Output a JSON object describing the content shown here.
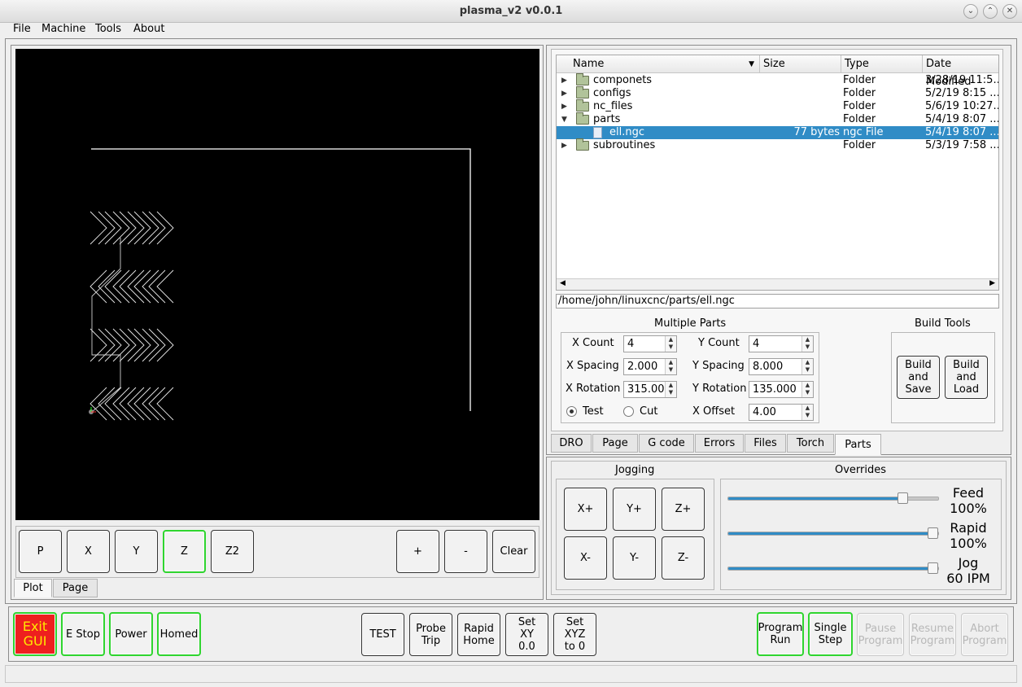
{
  "window": {
    "title": "plasma_v2 v0.0.1",
    "controls": [
      "⌄",
      "⌃",
      "✕"
    ]
  },
  "menu": [
    "File",
    "Machine",
    "Tools",
    "About"
  ],
  "plot_buttons": [
    "P",
    "X",
    "Y",
    "Z",
    "Z2",
    "+",
    "-",
    "Clear"
  ],
  "plot_tabs": [
    "Plot",
    "Page"
  ],
  "files": {
    "columns": [
      "Name",
      "Size",
      "Type",
      "Date Modified"
    ],
    "rows": [
      {
        "name": "componets",
        "size": "",
        "type": "Folder",
        "date": "3/28/19 11:5..."
      },
      {
        "name": "configs",
        "size": "",
        "type": "Folder",
        "date": "5/2/19 8:15 ..."
      },
      {
        "name": "nc_files",
        "size": "",
        "type": "Folder",
        "date": "5/6/19 10:27..."
      },
      {
        "name": "parts",
        "size": "",
        "type": "Folder",
        "date": "5/4/19 8:07 ..."
      },
      {
        "name": "ell.ngc",
        "size": "77 bytes",
        "type": "ngc File",
        "date": "5/4/19 8:07 ..."
      },
      {
        "name": "subroutines",
        "size": "",
        "type": "Folder",
        "date": "5/3/19 7:58 ..."
      }
    ],
    "path": "/home/john/linuxcnc/parts/ell.ngc"
  },
  "multiple_parts": {
    "title": "Multiple Parts",
    "x_count_label": "X Count",
    "x_count": "4",
    "y_count_label": "Y Count",
    "y_count": "4",
    "x_spacing_label": "X Spacing",
    "x_spacing": "2.000",
    "y_spacing_label": "Y Spacing",
    "y_spacing": "8.000",
    "x_rotation_label": "X Rotation",
    "x_rotation": "315.000",
    "y_rotation_label": "Y Rotation",
    "y_rotation": "135.000",
    "test_label": "Test",
    "cut_label": "Cut",
    "x_offset_label": "X Offset",
    "x_offset": "4.00"
  },
  "build_tools": {
    "title": "Build Tools",
    "build_save": "Build\nand\nSave",
    "build_load": "Build\nand\nLoad"
  },
  "right_tabs": [
    "DRO",
    "Page",
    "G code",
    "Errors",
    "Files",
    "Torch",
    "Parts"
  ],
  "jogging": {
    "title": "Jogging",
    "buttons": [
      "X+",
      "Y+",
      "Z+",
      "X-",
      "Y-",
      "Z-"
    ]
  },
  "overrides": {
    "title": "Overrides",
    "feed_label": "Feed",
    "feed_value": "100%",
    "feed_level": 0.85,
    "rapid_label": "Rapid",
    "rapid_value": "100%",
    "rapid_level": 1.0,
    "jog_label": "Jog",
    "jog_value": "60 IPM",
    "jog_level": 1.0
  },
  "bottom": {
    "exit": "Exit\nGUI",
    "estop": "E Stop",
    "power": "Power",
    "homed": "Homed",
    "test": "TEST",
    "probe": "Probe\nTrip",
    "rapid_home": "Rapid\nHome",
    "set_xy": "Set\nXY\n0.0",
    "set_xyz": "Set\nXYZ\nto 0",
    "program_run": "Program\nRun",
    "single_step": "Single\nStep",
    "pause": "Pause\nProgram",
    "resume": "Resume\nProgram",
    "abort": "Abort\nProgram"
  }
}
